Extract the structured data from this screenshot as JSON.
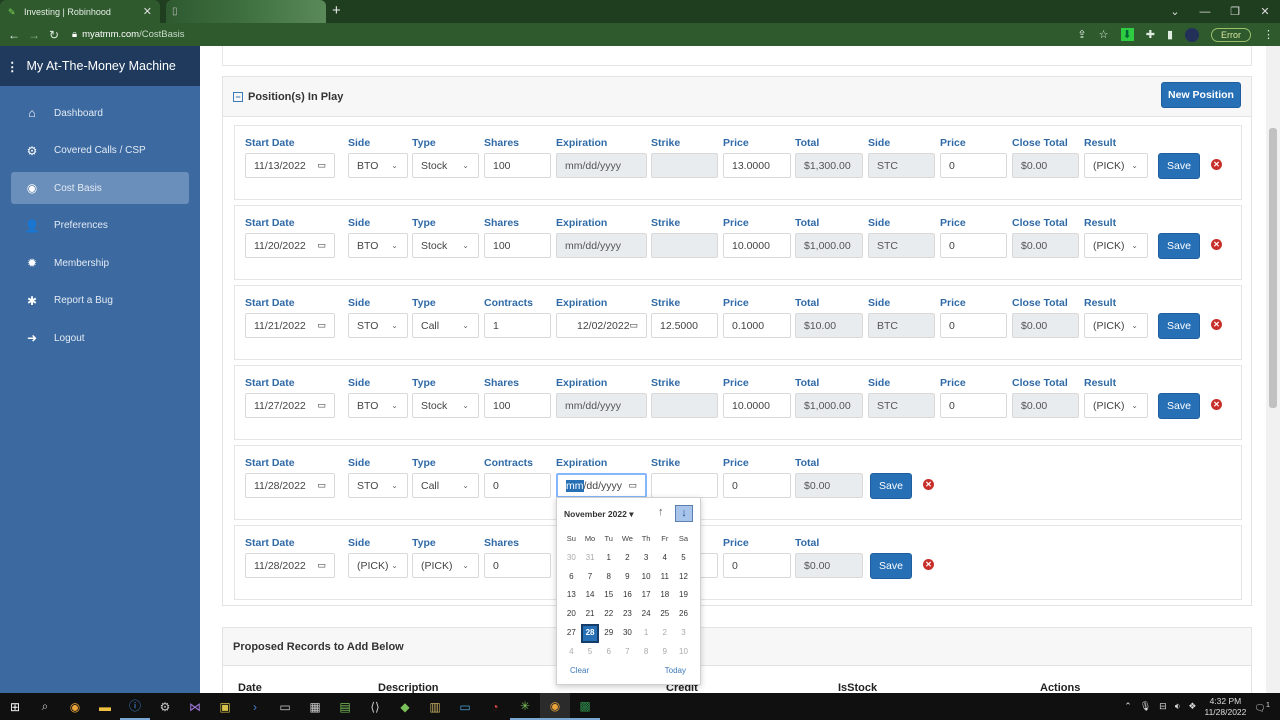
{
  "browser": {
    "tabs": [
      {
        "title": "Investing | Robinhood",
        "icon": "robinhood-feather-icon"
      },
      {
        "title": "",
        "icon": "page-icon"
      }
    ],
    "url_host": "myatmm.com",
    "url_path": "/CostBasis",
    "error_label": "Error"
  },
  "sidebar": {
    "brand": "My At-The-Money Machine",
    "items": [
      {
        "label": "Dashboard",
        "icon": "home-icon",
        "glyph": "⌂",
        "active": false
      },
      {
        "label": "Covered Calls / CSP",
        "icon": "gears-icon",
        "glyph": "⚙",
        "active": false
      },
      {
        "label": "Cost Basis",
        "icon": "money-icon",
        "glyph": "◉",
        "active": true
      },
      {
        "label": "Preferences",
        "icon": "user-cog-icon",
        "glyph": "👤",
        "active": false
      },
      {
        "label": "Membership",
        "icon": "cog-icon",
        "glyph": "✹",
        "active": false
      },
      {
        "label": "Report a Bug",
        "icon": "bug-icon",
        "glyph": "✱",
        "active": false
      },
      {
        "label": "Logout",
        "icon": "logout-icon",
        "glyph": "➜",
        "active": false
      }
    ]
  },
  "positions_card": {
    "title": "Position(s) In Play",
    "new_position_label": "New Position",
    "save_label": "Save",
    "rows": [
      {
        "start_date": "11/13/2022",
        "side": "BTO",
        "type": "Stock",
        "qty_label": "Shares",
        "qty": "100",
        "expiration": "mm/dd/yyyy",
        "strike": "",
        "price": "13.0000",
        "total": "$1,300.00",
        "close_side": "STC",
        "close_price": "0",
        "close_total": "$0.00",
        "result": "(PICK)"
      },
      {
        "start_date": "11/20/2022",
        "side": "BTO",
        "type": "Stock",
        "qty_label": "Shares",
        "qty": "100",
        "expiration": "mm/dd/yyyy",
        "strike": "",
        "price": "10.0000",
        "total": "$1,000.00",
        "close_side": "STC",
        "close_price": "0",
        "close_total": "$0.00",
        "result": "(PICK)"
      },
      {
        "start_date": "11/21/2022",
        "side": "STO",
        "type": "Call",
        "qty_label": "Contracts",
        "qty": "1",
        "expiration": "12/02/2022",
        "strike": "12.5000",
        "price": "0.1000",
        "total": "$10.00",
        "close_side": "BTC",
        "close_price": "0",
        "close_total": "$0.00",
        "result": "(PICK)"
      },
      {
        "start_date": "11/27/2022",
        "side": "BTO",
        "type": "Stock",
        "qty_label": "Shares",
        "qty": "100",
        "expiration": "mm/dd/yyyy",
        "strike": "",
        "price": "10.0000",
        "total": "$1,000.00",
        "close_side": "STC",
        "close_price": "0",
        "close_total": "$0.00",
        "result": "(PICK)"
      },
      {
        "start_date": "11/28/2022",
        "side": "STO",
        "type": "Call",
        "qty_label": "Contracts",
        "qty": "0",
        "expiration_sel": "mm",
        "expiration_rest": "/dd/yyyy",
        "strike": "",
        "price": "0",
        "total": "$0.00"
      },
      {
        "start_date": "11/28/2022",
        "side": "(PICK)",
        "type": "(PICK)",
        "qty_label": "Shares",
        "qty": "0",
        "expiration": "",
        "strike": "",
        "price": "0",
        "total": "$0.00"
      }
    ],
    "labels": {
      "start_date": "Start Date",
      "side": "Side",
      "type": "Type",
      "expiration": "Expiration",
      "strike": "Strike",
      "price": "Price",
      "total": "Total",
      "close_side": "Side",
      "close_price": "Price",
      "close_total": "Close Total",
      "result": "Result"
    }
  },
  "datepicker": {
    "month_label": "November 2022 ▾",
    "weekdays": [
      "Su",
      "Mo",
      "Tu",
      "We",
      "Th",
      "Fr",
      "Sa"
    ],
    "days": [
      [
        "30",
        "31",
        "1",
        "2",
        "3",
        "4",
        "5"
      ],
      [
        "6",
        "7",
        "8",
        "9",
        "10",
        "11",
        "12"
      ],
      [
        "13",
        "14",
        "15",
        "16",
        "17",
        "18",
        "19"
      ],
      [
        "20",
        "21",
        "22",
        "23",
        "24",
        "25",
        "26"
      ],
      [
        "27",
        "28",
        "29",
        "30",
        "1",
        "2",
        "3"
      ],
      [
        "4",
        "5",
        "6",
        "7",
        "8",
        "9",
        "10"
      ]
    ],
    "selected": "28",
    "clear_label": "Clear",
    "today_label": "Today"
  },
  "proposed_card": {
    "title": "Proposed Records to Add Below",
    "columns": [
      "Date",
      "Description",
      "Credit",
      "IsStock",
      "Actions"
    ]
  },
  "taskbar": {
    "time": "4:32 PM",
    "date": "11/28/2022",
    "notification_count": "1"
  }
}
